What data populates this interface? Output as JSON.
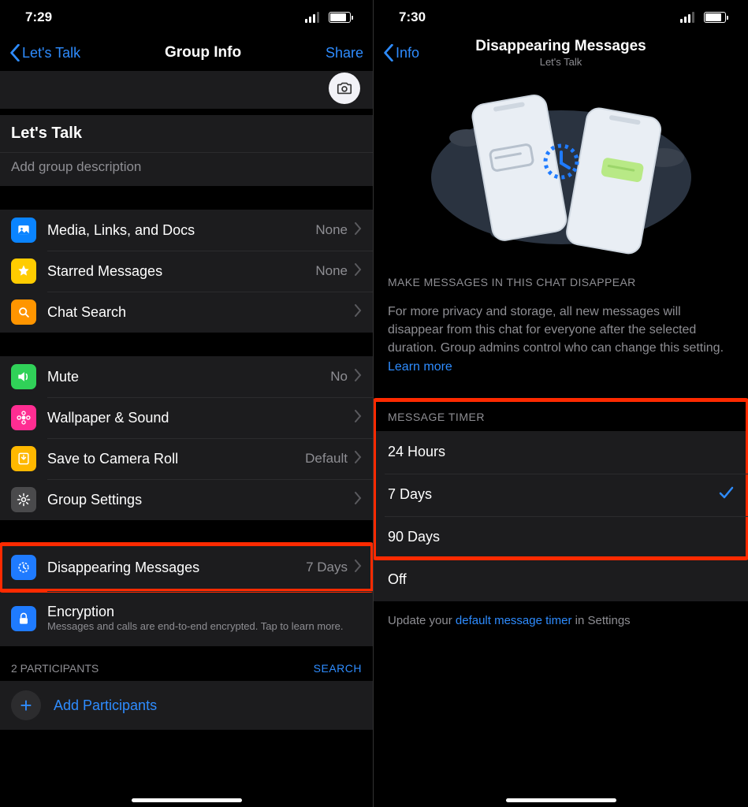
{
  "left": {
    "status": {
      "time": "7:29"
    },
    "nav": {
      "back": "Let's Talk",
      "title": "Group Info",
      "action": "Share"
    },
    "group": {
      "name": "Let's Talk",
      "addDescription": "Add group description"
    },
    "section1": {
      "media": {
        "label": "Media, Links, and Docs",
        "value": "None"
      },
      "starred": {
        "label": "Starred Messages",
        "value": "None"
      },
      "search": {
        "label": "Chat Search"
      }
    },
    "section2": {
      "mute": {
        "label": "Mute",
        "value": "No"
      },
      "wallpaper": {
        "label": "Wallpaper & Sound"
      },
      "saveRoll": {
        "label": "Save to Camera Roll",
        "value": "Default"
      },
      "groupSettings": {
        "label": "Group Settings"
      }
    },
    "section3": {
      "disappearing": {
        "label": "Disappearing Messages",
        "value": "7 Days"
      },
      "encryption": {
        "label": "Encryption",
        "sub": "Messages and calls are end-to-end encrypted. Tap to learn more."
      }
    },
    "participants": {
      "header": "2 PARTICIPANTS",
      "search": "SEARCH",
      "add": "Add Participants"
    }
  },
  "right": {
    "status": {
      "time": "7:30"
    },
    "nav": {
      "back": "Info",
      "title": "Disappearing Messages",
      "subtitle": "Let's Talk"
    },
    "desc": {
      "header": "MAKE MESSAGES IN THIS CHAT DISAPPEAR",
      "body": "For more privacy and storage, all new messages will disappear from this chat for everyone after the selected duration. Group admins control who can change this setting. ",
      "learnMore": "Learn more"
    },
    "timer": {
      "header": "MESSAGE TIMER",
      "options": {
        "o24h": "24 Hours",
        "o7d": "7 Days",
        "o90d": "90 Days",
        "off": "Off"
      },
      "selected": "o7d"
    },
    "footer": {
      "pre": "Update your ",
      "link": "default message timer",
      "post": " in Settings"
    }
  }
}
